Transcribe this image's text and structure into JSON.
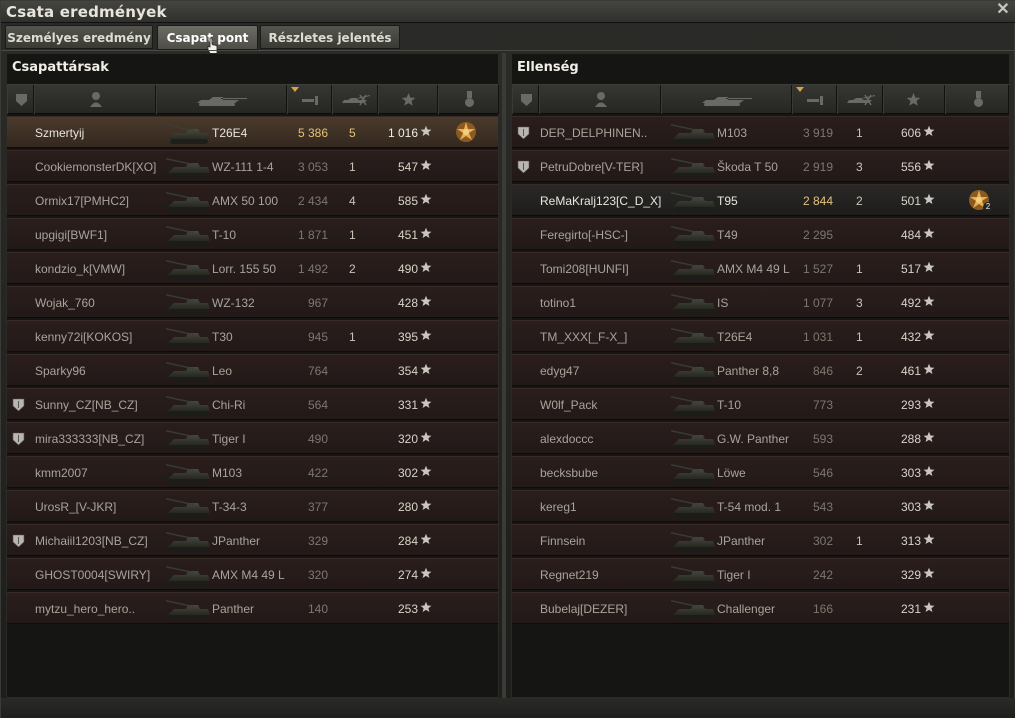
{
  "window": {
    "title": "Csata eredmények"
  },
  "tabs": [
    {
      "label": "Személyes eredmény"
    },
    {
      "label": "Csapat pont"
    },
    {
      "label": "Részletes jelentés"
    }
  ],
  "allies": {
    "title": "Csapattársak",
    "rows": [
      {
        "player": "Szmertyij",
        "vehicle": "T26E4",
        "damage": "5 386",
        "kills": "5",
        "xp": "1 016",
        "clan": false,
        "me": true,
        "medal": true
      },
      {
        "player": "CookiemonsterDK[XO]",
        "vehicle": "WZ-111 1-4",
        "damage": "3 053",
        "kills": "1",
        "xp": "547",
        "clan": false
      },
      {
        "player": "Ormix17[PMHC2]",
        "vehicle": "AMX 50 100",
        "damage": "2 434",
        "kills": "4",
        "xp": "585",
        "clan": false
      },
      {
        "player": "upgigi[BWF1]",
        "vehicle": "T-10",
        "damage": "1 871",
        "kills": "1",
        "xp": "451",
        "clan": false
      },
      {
        "player": "kondzio_k[VMW]",
        "vehicle": "Lorr. 155 50",
        "damage": "1 492",
        "kills": "2",
        "xp": "490",
        "clan": false
      },
      {
        "player": "Wojak_760",
        "vehicle": "WZ-132",
        "damage": "967",
        "kills": "",
        "xp": "428",
        "clan": false
      },
      {
        "player": "kenny72i[KOKOS]",
        "vehicle": "T30",
        "damage": "945",
        "kills": "1",
        "xp": "395",
        "clan": false
      },
      {
        "player": "Sparky96",
        "vehicle": "Leo",
        "damage": "764",
        "kills": "",
        "xp": "354",
        "clan": false
      },
      {
        "player": "Sunny_CZ[NB_CZ]",
        "vehicle": "Chi-Ri",
        "damage": "564",
        "kills": "",
        "xp": "331",
        "clan": true
      },
      {
        "player": "mira333333[NB_CZ]",
        "vehicle": "Tiger I",
        "damage": "490",
        "kills": "",
        "xp": "320",
        "clan": true
      },
      {
        "player": "kmm2007",
        "vehicle": "M103",
        "damage": "422",
        "kills": "",
        "xp": "302",
        "clan": false
      },
      {
        "player": "UrosR_[V-JKR]",
        "vehicle": "T-34-3",
        "damage": "377",
        "kills": "",
        "xp": "280",
        "clan": false
      },
      {
        "player": "Michaiil1203[NB_CZ]",
        "vehicle": "JPanther",
        "damage": "329",
        "kills": "",
        "xp": "284",
        "clan": true
      },
      {
        "player": "GHOST0004[SWIRY]",
        "vehicle": "AMX M4 49 L",
        "damage": "320",
        "kills": "",
        "xp": "274",
        "clan": false
      },
      {
        "player": "mytzu_hero_hero..",
        "vehicle": "Panther",
        "damage": "140",
        "kills": "",
        "xp": "253",
        "clan": false
      }
    ]
  },
  "enemies": {
    "title": "Ellenség",
    "rows": [
      {
        "player": "DER_DELPHINEN..",
        "vehicle": "M103",
        "damage": "3 919",
        "kills": "1",
        "xp": "606",
        "clan": true
      },
      {
        "player": "PetruDobre[V-TER]",
        "vehicle": "Škoda T 50",
        "damage": "2 919",
        "kills": "3",
        "xp": "556",
        "clan": true
      },
      {
        "player": "ReMaKralj123[C_D_X]",
        "vehicle": "T95",
        "damage": "2 844",
        "kills": "2",
        "xp": "501",
        "clan": false,
        "highlight": true,
        "medal": true,
        "medal_count": "2"
      },
      {
        "player": "Feregirto[-HSC-]",
        "vehicle": "T49",
        "damage": "2 295",
        "kills": "",
        "xp": "484",
        "clan": false
      },
      {
        "player": "Tomi208[HUNFI]",
        "vehicle": "AMX M4 49 L",
        "damage": "1 527",
        "kills": "1",
        "xp": "517",
        "clan": false
      },
      {
        "player": "totino1",
        "vehicle": "IS",
        "damage": "1 077",
        "kills": "3",
        "xp": "492",
        "clan": false
      },
      {
        "player": "TM_XXX[_F-X_]",
        "vehicle": "T26E4",
        "damage": "1 031",
        "kills": "1",
        "xp": "432",
        "clan": false
      },
      {
        "player": "edyg47",
        "vehicle": "Panther 8,8",
        "damage": "846",
        "kills": "2",
        "xp": "461",
        "clan": false
      },
      {
        "player": "W0lf_Pack",
        "vehicle": "T-10",
        "damage": "773",
        "kills": "",
        "xp": "293",
        "clan": false
      },
      {
        "player": "alexdoccc",
        "vehicle": "G.W. Panther",
        "damage": "593",
        "kills": "",
        "xp": "288",
        "clan": false
      },
      {
        "player": "becksbube",
        "vehicle": "Löwe",
        "damage": "546",
        "kills": "",
        "xp": "303",
        "clan": false
      },
      {
        "player": "kereg1",
        "vehicle": "T-54 mod. 1",
        "damage": "543",
        "kills": "",
        "xp": "303",
        "clan": false
      },
      {
        "player": "Finnsein",
        "vehicle": "JPanther",
        "damage": "302",
        "kills": "1",
        "xp": "313",
        "clan": false
      },
      {
        "player": "Regnet219",
        "vehicle": "Tiger I",
        "damage": "242",
        "kills": "",
        "xp": "329",
        "clan": false
      },
      {
        "player": "Bubelaj[DEZER]",
        "vehicle": "Challenger",
        "damage": "166",
        "kills": "",
        "xp": "231",
        "clan": false
      }
    ]
  },
  "colors": {
    "accent": "#d4a540",
    "row_bg": "#2a1e1c",
    "me_row_bg": "#4a3a2c"
  }
}
